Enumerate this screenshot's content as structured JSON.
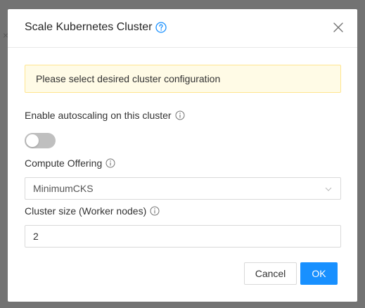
{
  "backdrop": {
    "glyph": "×"
  },
  "modal": {
    "title": "Scale Kubernetes Cluster",
    "alert_text": "Please select desired cluster configuration",
    "autoscaling": {
      "label": "Enable autoscaling on this cluster",
      "enabled": false
    },
    "compute_offering": {
      "label": "Compute Offering",
      "selected": "MinimumCKS"
    },
    "cluster_size": {
      "label": "Cluster size (Worker nodes)",
      "value": "2"
    },
    "buttons": {
      "cancel": "Cancel",
      "ok": "OK"
    }
  },
  "colors": {
    "primary": "#1890ff",
    "alert_bg": "#fffbe6",
    "alert_border": "#ffe58f",
    "switch_off": "#bfbfbf",
    "backdrop": "#737373"
  },
  "icons": {
    "help": "question-circle-icon",
    "close": "close-icon",
    "info": "info-circle-icon",
    "dropdown": "chevron-down-icon"
  }
}
